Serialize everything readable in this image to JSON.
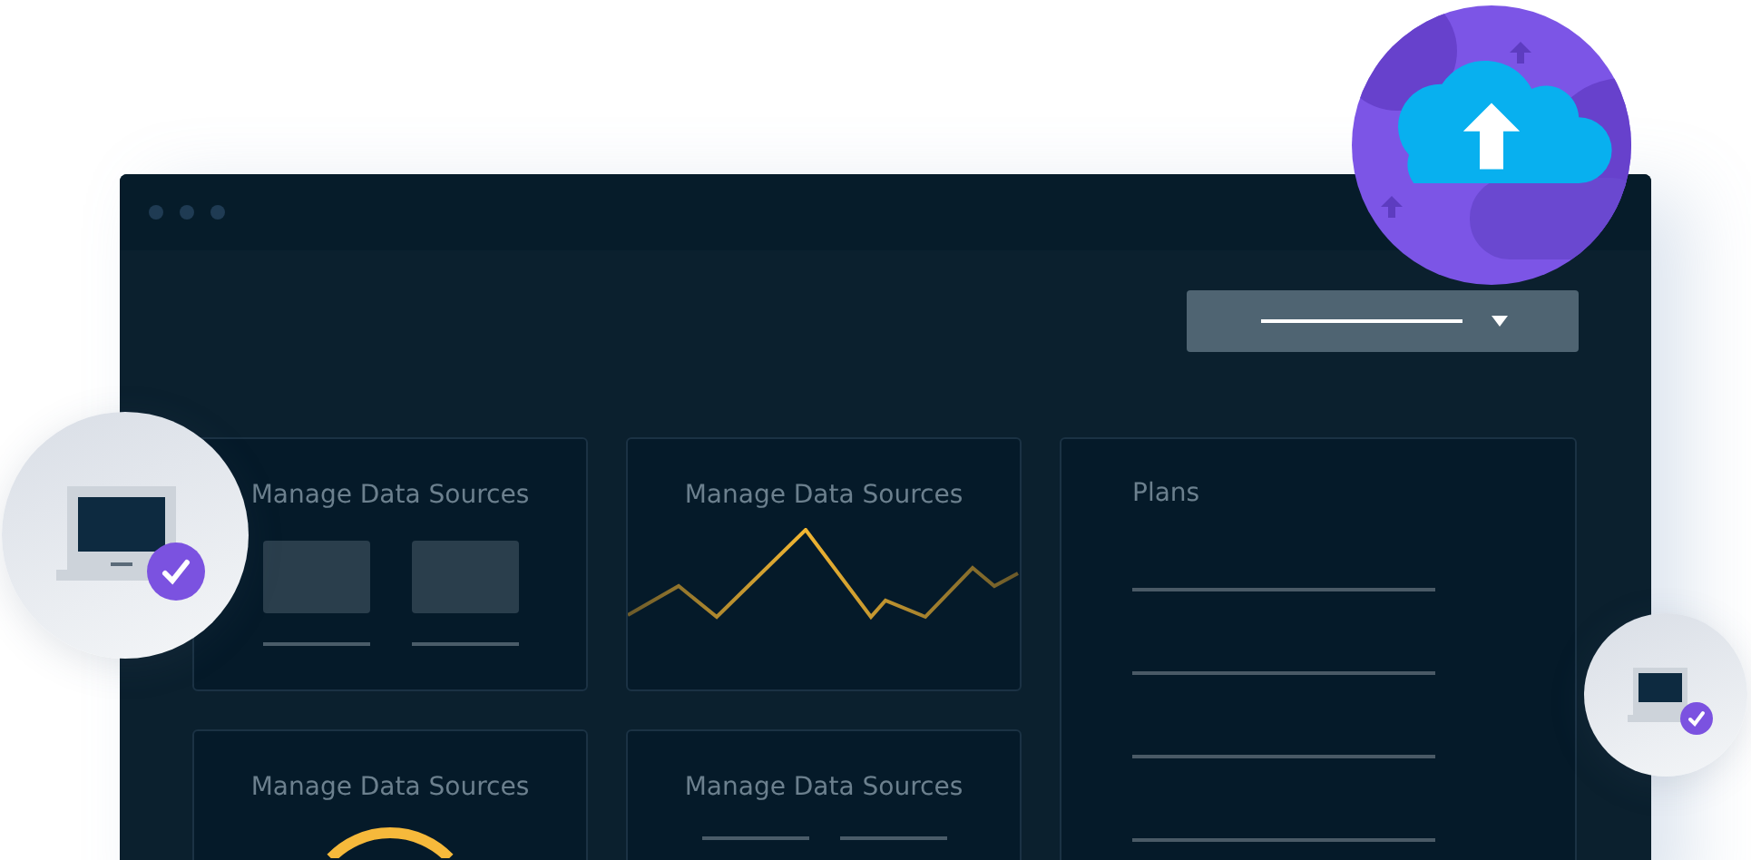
{
  "dashboard": {
    "cards": [
      {
        "kind": "blocks",
        "title": "Manage Data Sources"
      },
      {
        "kind": "line",
        "title": "Manage Data Sources"
      },
      {
        "kind": "ring",
        "title": "Manage Data Sources"
      },
      {
        "kind": "lines",
        "title": "Manage Data Sources"
      }
    ],
    "plans": {
      "title": "Plans"
    }
  }
}
